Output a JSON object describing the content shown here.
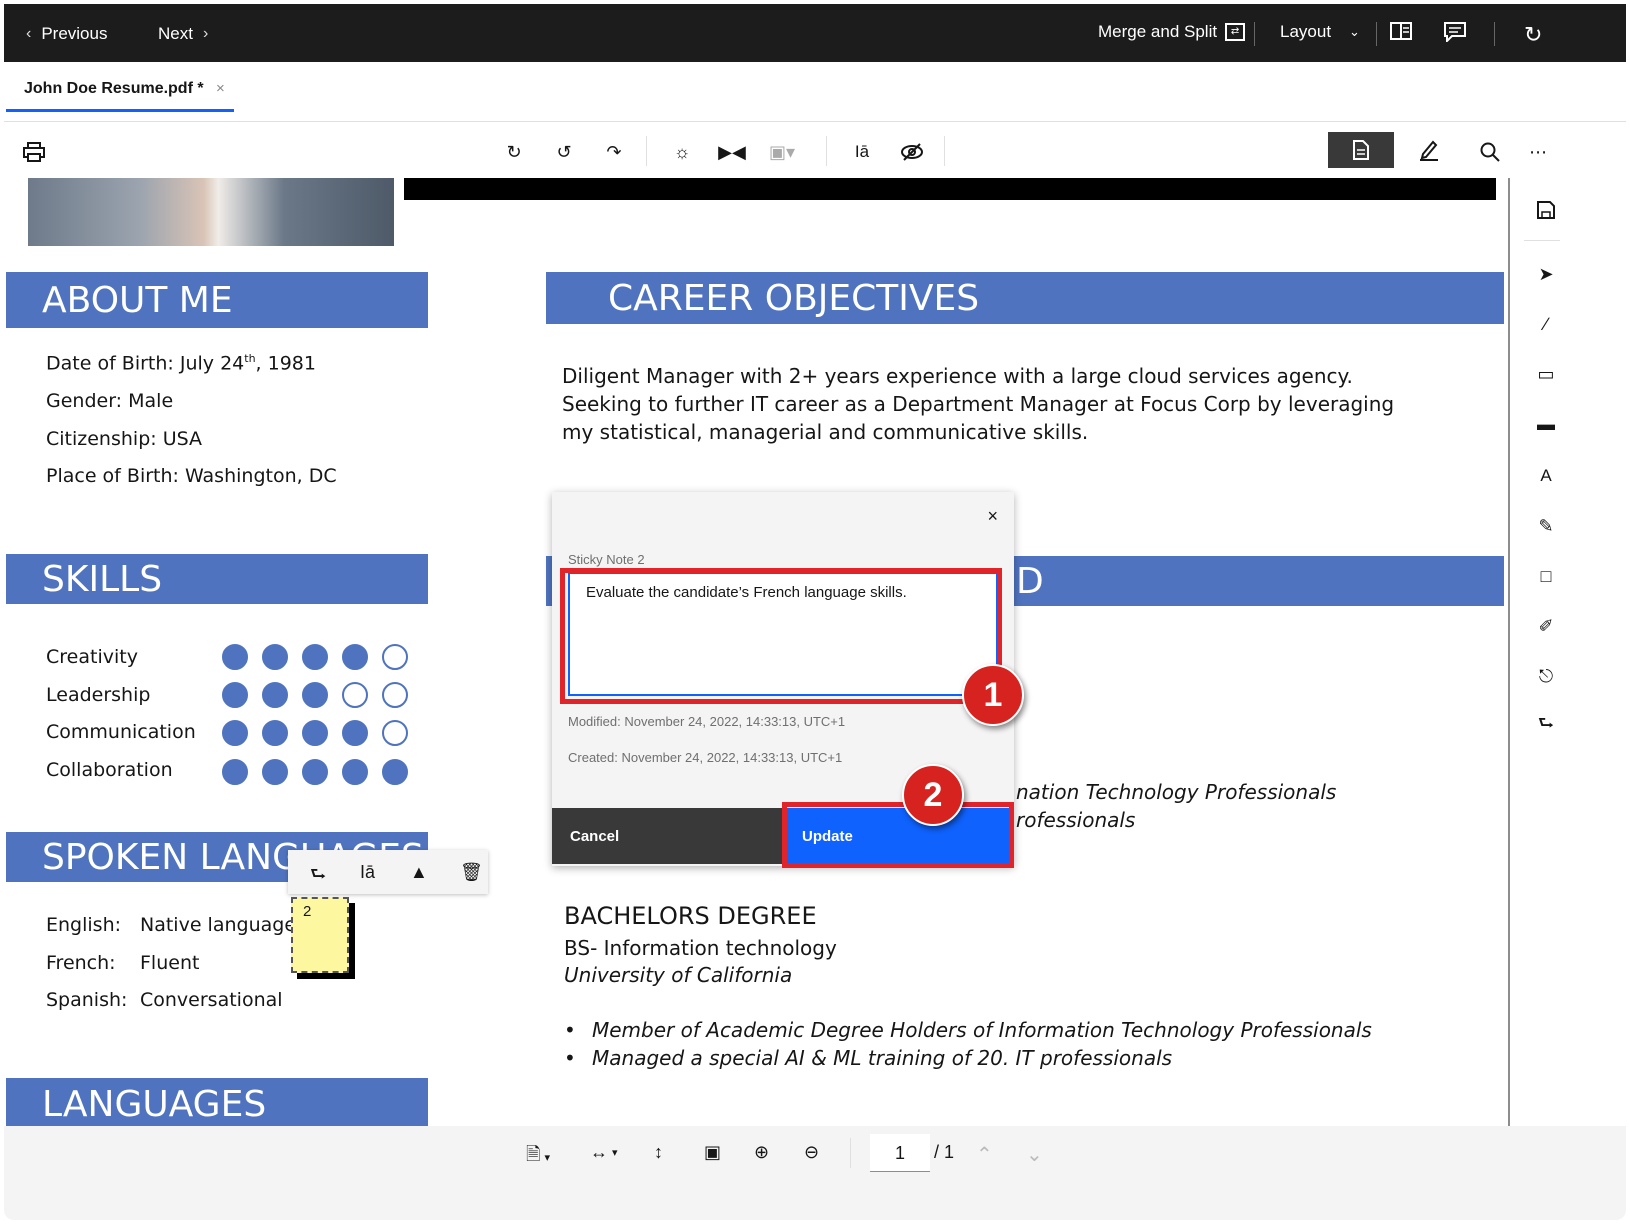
{
  "topbar": {
    "previous": "Previous",
    "next": "Next",
    "merge_split": "Merge and Split",
    "layout": "Layout"
  },
  "tab": {
    "title": "John Doe Resume.pdf *",
    "close": "×"
  },
  "resume": {
    "about_title": "ABOUT ME",
    "dob_prefix": "Date of Birth: July 24",
    "dob_sup": "th",
    "dob_suffix": ", 1981",
    "gender": "Gender: Male",
    "citizenship": "Citizenship: USA",
    "birthplace": "Place of Birth: Washington, DC",
    "skills_title": "SKILLS",
    "skills": [
      {
        "name": "Creativity",
        "level": 4
      },
      {
        "name": "Leadership",
        "level": 3
      },
      {
        "name": "Communication",
        "level": 4
      },
      {
        "name": "Collaboration",
        "level": 5
      }
    ],
    "spoken_title": "SPOKEN LANGUAGES",
    "spoken": [
      {
        "lang": "English:",
        "level": "Native language"
      },
      {
        "lang": "French:",
        "level": "Fluent"
      },
      {
        "lang": "Spanish:",
        "level": "Conversational"
      }
    ],
    "languages_title": "LANGUAGES",
    "career_title": "CAREER OBJECTIVES",
    "career_text": "Diligent Manager with 2+ years experience with a large cloud services agency. Seeking to further IT career as a Department Manager at Focus Corp  by leveraging my statistical, managerial and communicative skills.",
    "edu_title_partial": "D",
    "hidden_line1": "nation Technology Professionals",
    "hidden_line2": "rofessionals",
    "degree_title": "BACHELORS DEGREE",
    "degree_field": "BS- Information technology",
    "degree_school": "University of California",
    "bullets": [
      "Member of Academic Degree Holders of Information Technology Professionals",
      "Managed a special AI & ML training of 20. IT professionals"
    ]
  },
  "popup": {
    "label": "Sticky Note 2",
    "text": "Evaluate the candidate’s French language skills.",
    "modified": "Modified: November 24, 2022, 14:33:13, UTC+1",
    "created": "Created: November 24, 2022, 14:33:13, UTC+1",
    "cancel": "Cancel",
    "update": "Update",
    "close": "×"
  },
  "sticky_note": {
    "number": "2"
  },
  "callouts": [
    "1",
    "2"
  ],
  "pager": {
    "page": "1",
    "total": "/ 1"
  },
  "colors": {
    "accent": "#0f62fe",
    "section": "#4f73bf",
    "callout": "#e0242a"
  }
}
